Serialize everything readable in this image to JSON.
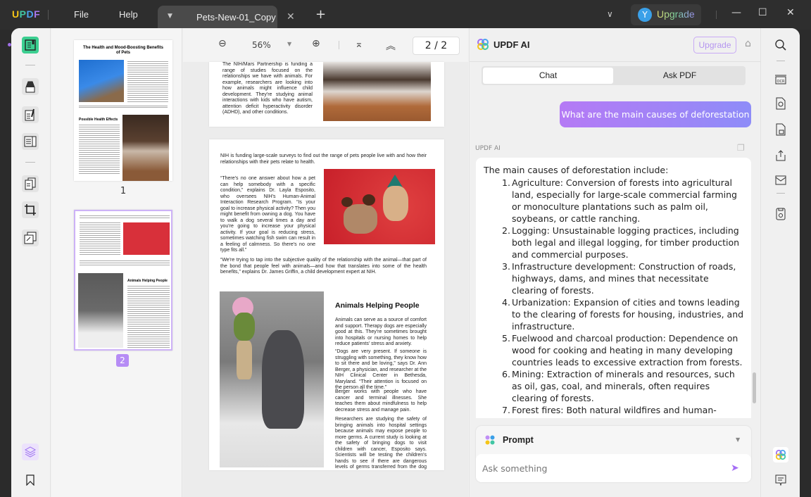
{
  "titlebar": {
    "logo": {
      "u": "U",
      "p": "P",
      "d": "D",
      "f": "F"
    },
    "menu": [
      "File",
      "Help"
    ],
    "tab_title": "Pets-New-01_Copy",
    "avatar_initial": "Y",
    "upgrade_label": "Upgrade"
  },
  "toolbar": {
    "zoom": "56%",
    "page_indicator": "2 / 2"
  },
  "thumbnails": [
    {
      "page": "1",
      "selected": false
    },
    {
      "page": "2",
      "selected": true
    }
  ],
  "document": {
    "page1_tail": "The NIH/Mars Partnership is funding a range of studies focused on the relationships we have with animals. For example, researchers are looking into how animals might influence child development. They're studying animal interactions with kids who have autism, attention deficit hyperactivity disorder (ADHD), and other conditions.",
    "page2_intro": "NIH is funding large-scale surveys to find out the range of pets people live with and how their relationships with their pets relate to health.",
    "page2_quote1": "“There's no one answer about how a pet can help somebody with a specific condition,” explains Dr. Layla Esposito, who oversees NIH's Human-Animal Interaction Research Program. “Is your goal to increase physical activity? Then you might benefit from owning a dog. You have to walk a dog several times a day and you're going to increase your physical activity. If your goal is reducing stress, sometimes watching fish swim can result in a feeling of calmness. So there's no one type fits all.”",
    "page2_quote2": "“We're trying to tap into the subjective quality of the relationship with the animal—that part of the bond that people feel with animals—and how that translates into some of the health benefits,” explains Dr. James Griffin, a child development expert at NIH.",
    "section_heading": "Animals Helping People",
    "section_p1": "Animals can serve as a source of comfort and support. Therapy dogs are especially good at this. They're sometimes brought into hospitals or nursing homes to help reduce patients' stress and anxiety.",
    "section_p2": "“Dogs are very present. If someone is struggling with something, they know how to sit there and be loving,” says Dr. Ann Berger, a physician, and researcher at the NIH Clinical Center in Bethesda, Maryland. “Their attention is focused on the person all the time.”",
    "section_p3": "Berger works with people who have cancer and terminal illnesses. She teaches them about mindfulness to help decrease stress and manage pain.",
    "section_p4": "Researchers are studying the safety of bringing animals into hospital settings because animals may expose people to more germs. A current study is looking at the safety of bringing dogs to visit children with cancer, Esposito says. Scientists will be testing the children's hands to see if there are dangerous levels of germs transferred from the dog after the visit.",
    "thumb1_title": "The Health and Mood-Boosting Benefits of Pets",
    "thumb1_heading": "Possible Health Effects"
  },
  "ai": {
    "title": "UPDF AI",
    "upgrade_label": "Upgrade",
    "tabs": [
      "Chat",
      "Ask PDF"
    ],
    "user_message": "What are the main causes of deforestation",
    "sender_label": "UPDF AI",
    "response_intro": "The main causes of deforestation include:",
    "response_items": [
      {
        "n": "1.",
        "text": "Agriculture: Conversion of forests into agricultural land, especially for large-scale commercial farming or monoculture plantations such as palm oil, soybeans, or cattle ranching."
      },
      {
        "n": "2.",
        "text": "Logging: Unsustainable logging practices, including both legal and illegal logging, for timber production and commercial purposes."
      },
      {
        "n": "3.",
        "text": "Infrastructure development: Construction of roads, highways, dams, and mines that necessitate clearing of forests."
      },
      {
        "n": "4.",
        "text": "Urbanization: Expansion of cities and towns leading to the clearing of forests for housing, industries, and infrastructure."
      },
      {
        "n": "5.",
        "text": "Fuelwood and charcoal production: Dependence on wood for cooking and heating in many developing countries leads to excessive extraction from forests."
      },
      {
        "n": "6.",
        "text": "Mining: Extraction of minerals and resources, such as oil, gas, coal, and minerals, often requires clearing of forests."
      },
      {
        "n": "7.",
        "text": "Forest fires: Both natural wildfires and human-induced fires can lead to deforestation."
      }
    ],
    "prompt_label": "Prompt",
    "input_placeholder": "Ask something"
  },
  "colors": {
    "accent": "#a56ef5",
    "active_tool": "#3ccf91",
    "user_bubble_start": "#b57af5",
    "user_bubble_end": "#8e8cf8"
  }
}
